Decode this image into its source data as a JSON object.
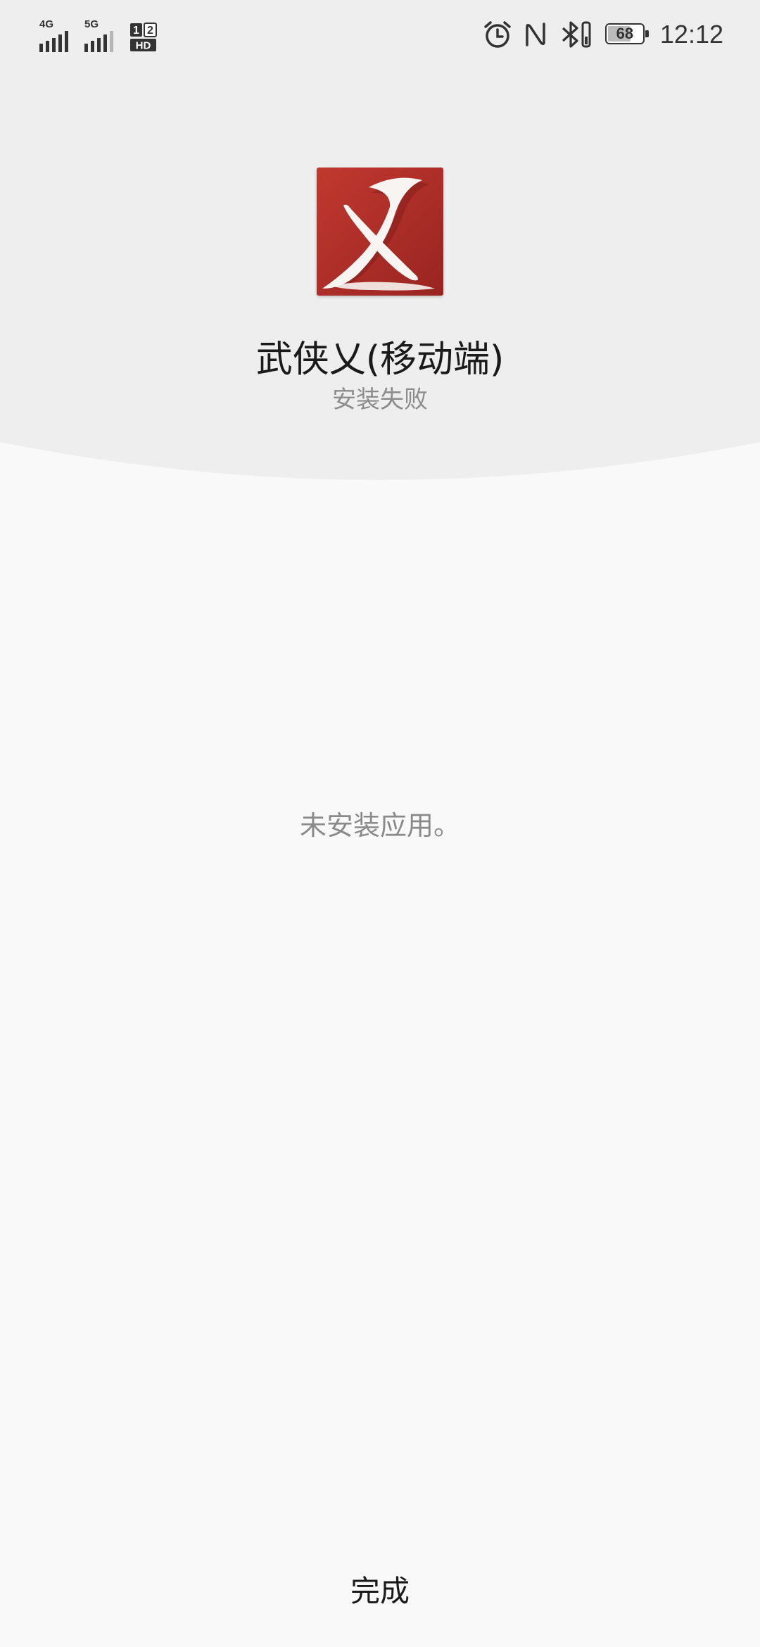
{
  "status_bar": {
    "network_1": "4G",
    "network_2": "5G",
    "sim_badge_top_1": "1",
    "sim_badge_top_2": "2",
    "sim_badge_bottom": "HD",
    "battery_level": "68",
    "time": "12:12"
  },
  "app": {
    "name": "武侠乂(移动端)",
    "install_status": "安装失败"
  },
  "message": "未安装应用。",
  "actions": {
    "done_label": "完成"
  },
  "colors": {
    "header_bg": "#eeeeee",
    "page_bg": "#f9f9f9",
    "icon_red": "#b3312c"
  }
}
